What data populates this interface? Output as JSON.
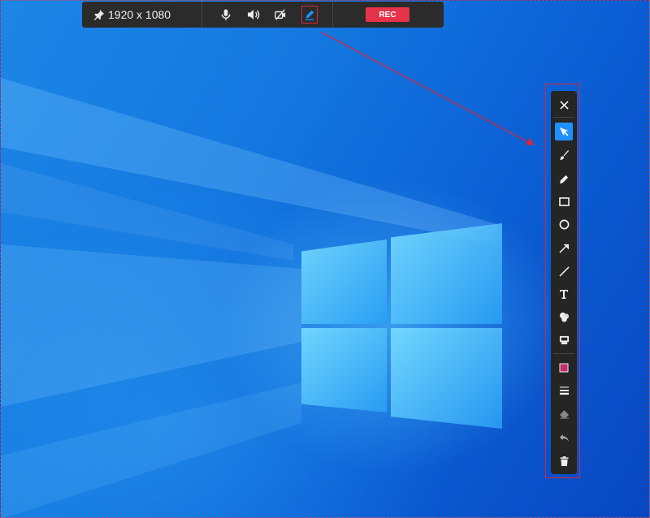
{
  "toolbar": {
    "resolution": "1920 x 1080",
    "rec_label": "REC",
    "icons": [
      "pin-icon",
      "microphone-icon",
      "speaker-icon",
      "camera-off-icon",
      "annotate-pen-icon"
    ]
  },
  "annotation_toolbar": {
    "tools": [
      "close",
      "select",
      "brush",
      "pencil",
      "rectangle",
      "ellipse",
      "arrow",
      "line",
      "text",
      "color-fill",
      "stamp",
      "color-swatch",
      "line-width",
      "eraser",
      "undo",
      "delete"
    ],
    "active_tool": "select",
    "swatch_color": "#c0306a",
    "active_color": "#1e90ff"
  },
  "colors": {
    "toolbar_bg": "#2b2b2b",
    "rec_button": "#e5334a",
    "highlight_box": "#d7263d"
  }
}
